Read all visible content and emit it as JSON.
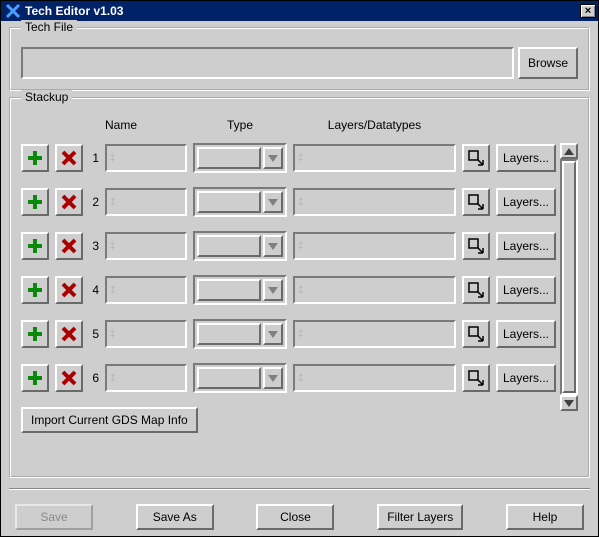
{
  "window": {
    "title": "Tech Editor v1.03"
  },
  "techfile": {
    "legend": "Tech File",
    "path": "",
    "browse_label": "Browse"
  },
  "stackup": {
    "legend": "Stackup",
    "headers": {
      "name": "Name",
      "type": "Type",
      "ld": "Layers/Datatypes"
    },
    "rows": [
      {
        "num": "1",
        "name": "",
        "type": "",
        "ld": "",
        "layers_btn": "Layers..."
      },
      {
        "num": "2",
        "name": "",
        "type": "",
        "ld": "",
        "layers_btn": "Layers..."
      },
      {
        "num": "3",
        "name": "",
        "type": "",
        "ld": "",
        "layers_btn": "Layers..."
      },
      {
        "num": "4",
        "name": "",
        "type": "",
        "ld": "",
        "layers_btn": "Layers..."
      },
      {
        "num": "5",
        "name": "",
        "type": "",
        "ld": "",
        "layers_btn": "Layers..."
      },
      {
        "num": "6",
        "name": "",
        "type": "",
        "ld": "",
        "layers_btn": "Layers..."
      }
    ],
    "import_label": "Import Current GDS Map Info"
  },
  "buttons": {
    "save": "Save",
    "save_as": "Save As",
    "close": "Close",
    "filter": "Filter Layers",
    "help": "Help"
  }
}
